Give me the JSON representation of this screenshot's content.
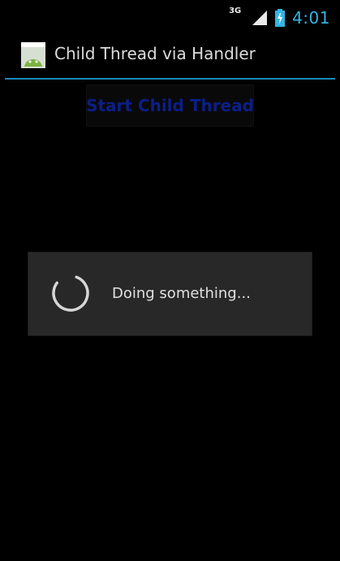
{
  "status_bar": {
    "network_type": "3G",
    "time": "4:01",
    "accent_color": "#33b5e5"
  },
  "action_bar": {
    "title": "Child Thread via Handler",
    "icon": "app-icon"
  },
  "main": {
    "start_button_label": "Start Child Thread"
  },
  "dialog": {
    "message": "Doing something...",
    "spinner_icon": "loading-spinner-icon"
  },
  "colors": {
    "action_divider": "#1a89b7",
    "dialog_bg": "#282828",
    "button_text": "#0b1e88"
  }
}
